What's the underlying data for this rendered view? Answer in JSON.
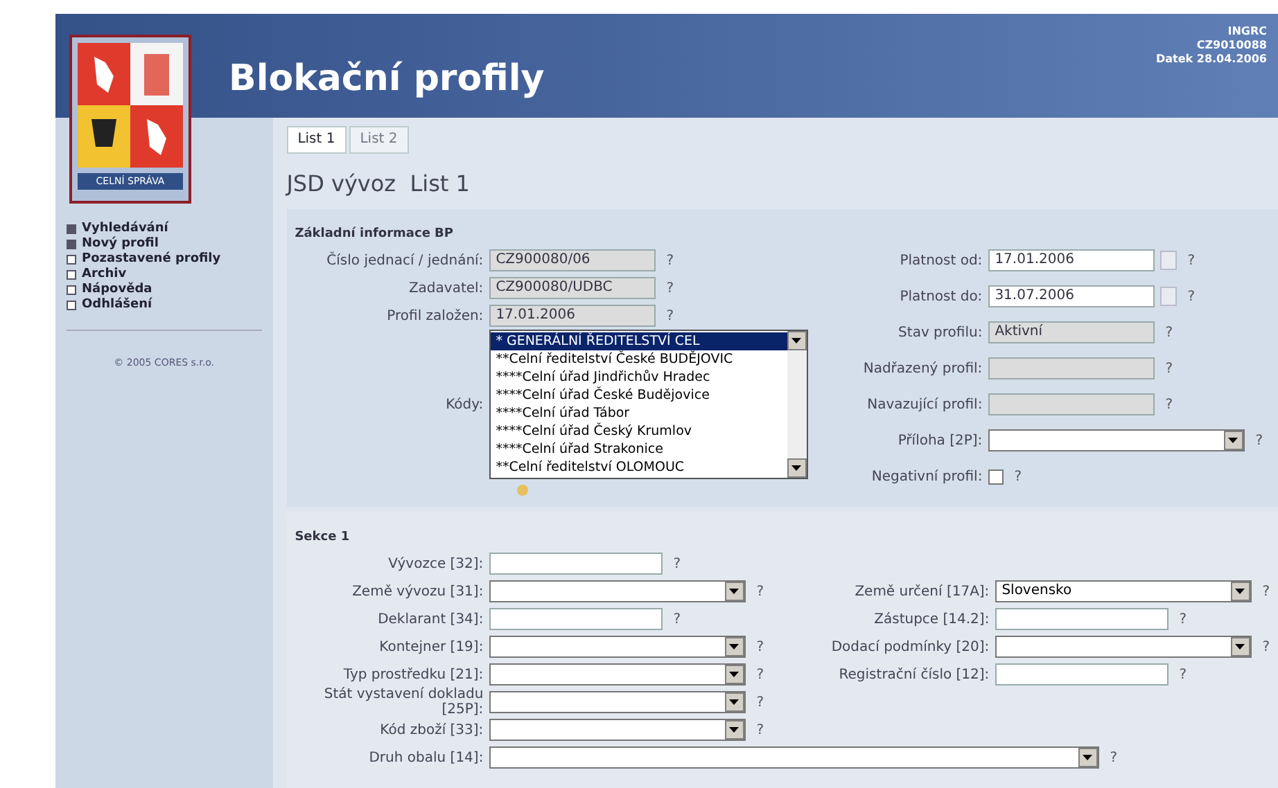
{
  "header": {
    "title": "Blokační profily",
    "logo_caption": "CELNÍ SPRÁVA",
    "user_info": [
      "INGRC",
      "CZ9010088",
      "Datek 28.04.2006"
    ]
  },
  "sidebar": {
    "items": [
      {
        "label": "Vyhledávání",
        "kind": "filled"
      },
      {
        "label": "Nový profil",
        "kind": "filled"
      },
      {
        "label": "Pozastavené profily",
        "kind": "empty"
      },
      {
        "label": "Archiv",
        "kind": "empty"
      },
      {
        "label": "Nápověda",
        "kind": "empty"
      },
      {
        "label": "Odhlášení",
        "kind": "empty"
      }
    ],
    "copyright": "© 2005 CORES s.r.o."
  },
  "tabs": [
    {
      "label": "List 1",
      "selected": true
    },
    {
      "label": "List 2",
      "selected": false
    }
  ],
  "heading": "JSD vývoz  List 1",
  "basic": {
    "title": "Základní informace BP",
    "left": [
      {
        "label": "Číslo jednací / jednání:",
        "kind": "readonly",
        "value": "CZ900080/06",
        "help": "?"
      },
      {
        "label": "Zadavatel:",
        "kind": "readonly",
        "value": "CZ900080/UDBC",
        "help": "?"
      },
      {
        "label": "Profil založen:",
        "kind": "readonly",
        "value": "17.01.2006",
        "help": "?"
      },
      {
        "label": "Kódy:",
        "kind": "listbox",
        "options": [
          {
            "label": "* GENERÁLNÍ ŘEDITELSTVÍ CEL",
            "selected": true
          },
          {
            "label": "**Celní ředitelství České BUDĚJOVIC",
            "selected": false
          },
          {
            "label": "****Celní úřad Jindřichův Hradec",
            "selected": false
          },
          {
            "label": "****Celní úřad České Budějovice",
            "selected": false
          },
          {
            "label": "****Celní úřad Tábor",
            "selected": false
          },
          {
            "label": "****Celní úřad Český Krumlov",
            "selected": false
          },
          {
            "label": "****Celní úřad Strakonice",
            "selected": false
          },
          {
            "label": "**Celní ředitelství OLOMOUC",
            "selected": false
          }
        ]
      }
    ],
    "right": [
      {
        "label": "Platnost od:",
        "kind": "date",
        "value": "17.01.2006",
        "help": "?"
      },
      {
        "label": "Platnost do:",
        "kind": "date",
        "value": "31.07.2006",
        "help": "?"
      },
      {
        "label": "Stav profilu:",
        "kind": "readonly",
        "value": "Aktivní",
        "help": "?"
      },
      {
        "label": "Nadřazený profil:",
        "kind": "readonly",
        "help": "?"
      },
      {
        "label": "Navazující profil:",
        "kind": "readonly",
        "help": "?"
      },
      {
        "label": "Příloha [2P]:",
        "kind": "select",
        "help": "?"
      },
      {
        "label": "Negativní profil:",
        "kind": "checkbox",
        "checked": false,
        "help": "?"
      }
    ]
  },
  "section1": {
    "title": "Sekce 1",
    "rows": [
      {
        "left": {
          "label": "Vývozce [32]:",
          "kind": "text",
          "help": "?"
        }
      },
      {
        "left": {
          "label": "Země vývozu [31]:",
          "kind": "select",
          "help": "?"
        },
        "right": {
          "label": "Země určení [17A]:",
          "kind": "select",
          "value": "Slovensko",
          "help": "?"
        }
      },
      {
        "left": {
          "label": "Deklarant [34]:",
          "kind": "text",
          "help": "?"
        },
        "right": {
          "label": "Zástupce [14.2]:",
          "kind": "text",
          "help": "?"
        }
      },
      {
        "left": {
          "label": "Kontejner [19]:",
          "kind": "select",
          "help": "?"
        },
        "right": {
          "label": "Dodací podmínky [20]:",
          "kind": "select",
          "help": "?"
        }
      },
      {
        "left": {
          "label": "Typ prostředku [21]:",
          "kind": "select",
          "help": "?"
        },
        "right": {
          "label": "Registrační číslo [12]:",
          "kind": "text",
          "help": "?"
        }
      },
      {
        "left": {
          "label": "Stát vystavení dokladu [25P]:",
          "kind": "select",
          "help": "?"
        }
      },
      {
        "left": {
          "label": "Kód zboží [33]:",
          "kind": "select",
          "help": "?"
        }
      },
      {
        "left": {
          "label": "Druh obalu [14]:",
          "kind": "wide",
          "help": "?"
        }
      }
    ]
  }
}
